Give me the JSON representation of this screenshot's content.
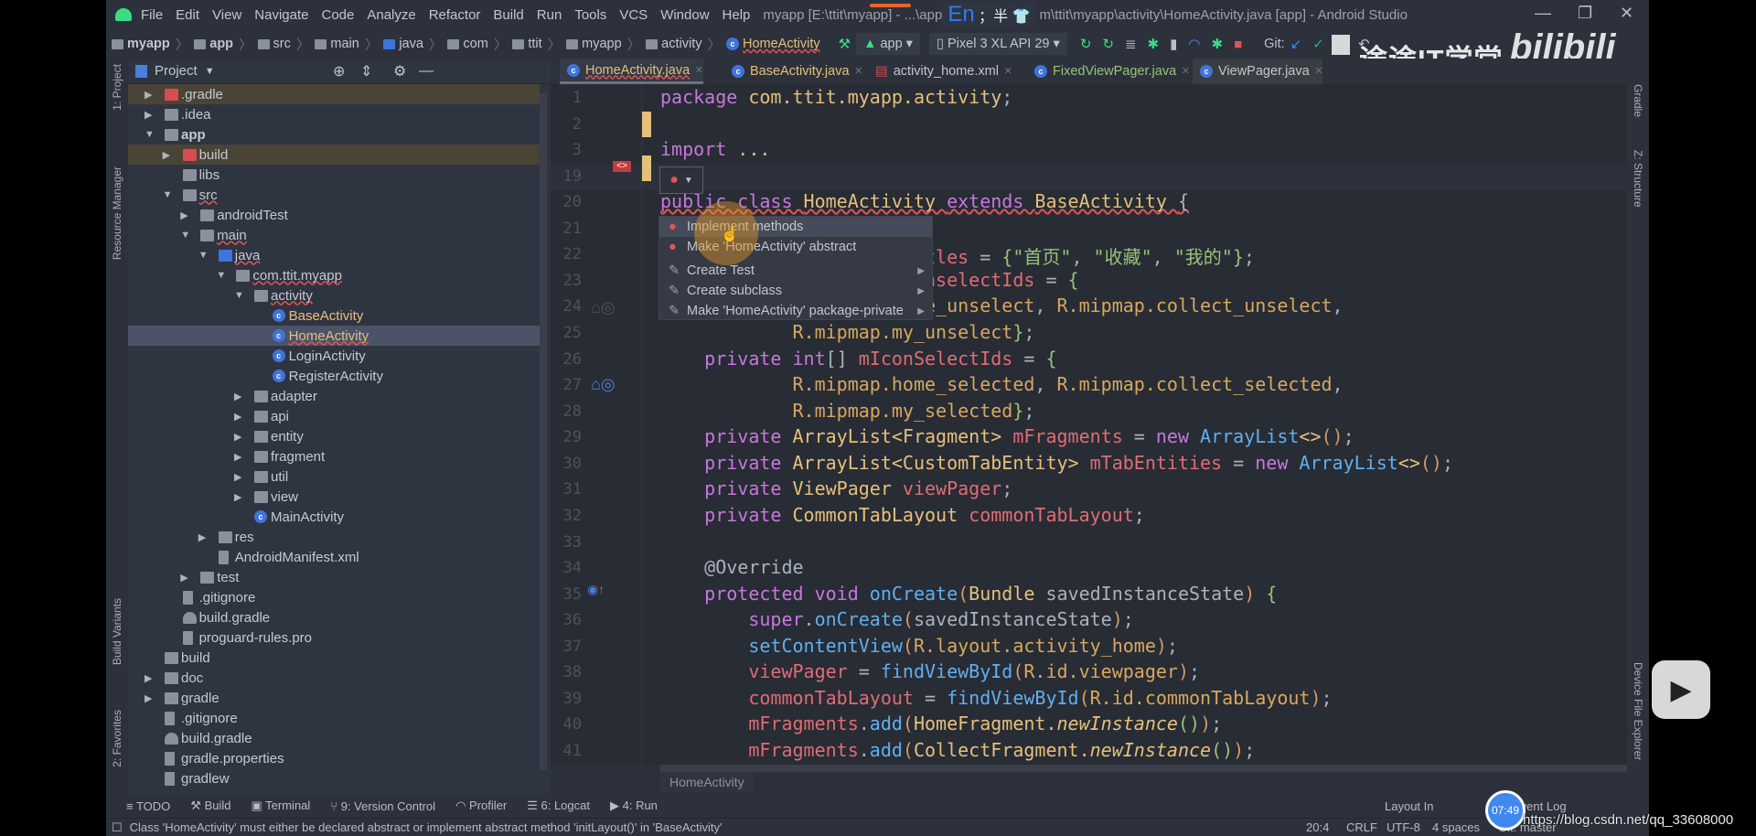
{
  "titlebar": {
    "menu": [
      "File",
      "Edit",
      "View",
      "Navigate",
      "Code",
      "Analyze",
      "Refactor",
      "Build",
      "Run",
      "Tools",
      "VCS",
      "Window",
      "Help"
    ],
    "title_left": "myapp [E:\\ttit\\myapp] - ...\\app",
    "title_right": "m\\ttit\\myapp\\activity\\HomeActivity.java [app] - Android Studio",
    "ime_lang": "En",
    "ime_extra": "；半"
  },
  "navbar": {
    "breadcrumbs": [
      "myapp",
      "app",
      "src",
      "main",
      "java",
      "com",
      "ttit",
      "myapp",
      "activity",
      "HomeActivity"
    ],
    "run_config": "app",
    "device": "Pixel 3 XL API 29",
    "git_label": "Git:"
  },
  "watermark": {
    "channel": "途途IT学堂",
    "logo": "bilibili",
    "url": "https://blog.csdn.net/qq_33608000",
    "time_bubble": "07:49"
  },
  "left_stripe": [
    "1: Project",
    "Resource Manager",
    "Build Variants",
    "2: Favorites"
  ],
  "right_stripe": [
    "Gradle",
    "Z: Structure",
    "Device File Explorer"
  ],
  "project": {
    "title": "Project",
    "tree": [
      {
        "label": ".gradle",
        "depth": 0,
        "arrow": "right",
        "icon": "folder-red",
        "hl": "brown"
      },
      {
        "label": ".idea",
        "depth": 0,
        "arrow": "right",
        "icon": "folder"
      },
      {
        "label": "app",
        "depth": 0,
        "arrow": "down",
        "icon": "module",
        "bold": true
      },
      {
        "label": "build",
        "depth": 1,
        "arrow": "right",
        "icon": "folder-red",
        "hl": "brown"
      },
      {
        "label": "libs",
        "depth": 1,
        "arrow": "",
        "icon": "folder"
      },
      {
        "label": "src",
        "depth": 1,
        "arrow": "down",
        "icon": "folder"
      },
      {
        "label": "androidTest",
        "depth": 2,
        "arrow": "right",
        "icon": "folder"
      },
      {
        "label": "main",
        "depth": 2,
        "arrow": "down",
        "icon": "folder"
      },
      {
        "label": "java",
        "depth": 3,
        "arrow": "down",
        "icon": "folder-blue"
      },
      {
        "label": "com.ttit.myapp",
        "depth": 4,
        "arrow": "down",
        "icon": "package"
      },
      {
        "label": "activity",
        "depth": 5,
        "arrow": "down",
        "icon": "package"
      },
      {
        "label": "BaseActivity",
        "depth": 6,
        "arrow": "",
        "icon": "class",
        "color": "#e5c07b"
      },
      {
        "label": "HomeActivity",
        "depth": 6,
        "arrow": "",
        "icon": "class",
        "color": "#e5c07b",
        "hl": "sel"
      },
      {
        "label": "LoginActivity",
        "depth": 6,
        "arrow": "",
        "icon": "class"
      },
      {
        "label": "RegisterActivity",
        "depth": 6,
        "arrow": "",
        "icon": "class"
      },
      {
        "label": "adapter",
        "depth": 5,
        "arrow": "right",
        "icon": "package"
      },
      {
        "label": "api",
        "depth": 5,
        "arrow": "right",
        "icon": "package"
      },
      {
        "label": "entity",
        "depth": 5,
        "arrow": "right",
        "icon": "package"
      },
      {
        "label": "fragment",
        "depth": 5,
        "arrow": "right",
        "icon": "package"
      },
      {
        "label": "util",
        "depth": 5,
        "arrow": "right",
        "icon": "package"
      },
      {
        "label": "view",
        "depth": 5,
        "arrow": "right",
        "icon": "package"
      },
      {
        "label": "MainActivity",
        "depth": 5,
        "arrow": "",
        "icon": "class"
      },
      {
        "label": "res",
        "depth": 3,
        "arrow": "right",
        "icon": "folder"
      },
      {
        "label": "AndroidManifest.xml",
        "depth": 3,
        "arrow": "",
        "icon": "manifest"
      },
      {
        "label": "test",
        "depth": 2,
        "arrow": "right",
        "icon": "folder"
      },
      {
        "label": ".gitignore",
        "depth": 1,
        "arrow": "",
        "icon": "file"
      },
      {
        "label": "build.gradle",
        "depth": 1,
        "arrow": "",
        "icon": "gradle"
      },
      {
        "label": "proguard-rules.pro",
        "depth": 1,
        "arrow": "",
        "icon": "file"
      },
      {
        "label": "build",
        "depth": 0,
        "arrow": "",
        "icon": "folder"
      },
      {
        "label": "doc",
        "depth": 0,
        "arrow": "right",
        "icon": "folder"
      },
      {
        "label": "gradle",
        "depth": 0,
        "arrow": "right",
        "icon": "folder"
      },
      {
        "label": ".gitignore",
        "depth": 0,
        "arrow": "",
        "icon": "file"
      },
      {
        "label": "build.gradle",
        "depth": 0,
        "arrow": "",
        "icon": "gradle"
      },
      {
        "label": "gradle.properties",
        "depth": 0,
        "arrow": "",
        "icon": "file"
      },
      {
        "label": "gradlew",
        "depth": 0,
        "arrow": "",
        "icon": "file"
      }
    ]
  },
  "tabs": [
    {
      "label": "HomeActivity.java",
      "active": true,
      "color": "#e5c07b",
      "icon": "class"
    },
    {
      "label": "BaseActivity.java",
      "color": "#e5c07b",
      "icon": "class"
    },
    {
      "label": "activity_home.xml",
      "color": "#c2c6ce",
      "icon": "xml"
    },
    {
      "label": "FixedViewPager.java",
      "color": "#98c379",
      "icon": "class"
    },
    {
      "label": "ViewPager.java",
      "color": "#c2c6ce",
      "icon": "class",
      "readonly": true
    }
  ],
  "editor": {
    "lines": [
      {
        "n": "1",
        "tk": [
          [
            "k",
            "package "
          ],
          [
            "t",
            "com.ttit.myapp.activity"
          ],
          [
            "p",
            ";"
          ]
        ]
      },
      {
        "n": "2",
        "tk": []
      },
      {
        "n": "3",
        "tk": [
          [
            "k",
            "import "
          ],
          [
            "t",
            "..."
          ]
        ]
      },
      {
        "n": "19",
        "tk": []
      },
      {
        "n": "20",
        "err": true,
        "tk": [
          [
            "k",
            "public class "
          ],
          [
            "t",
            "HomeActivity "
          ],
          [
            "k",
            "extends "
          ],
          [
            "t",
            "BaseActivity "
          ],
          [
            "p",
            "{"
          ]
        ]
      },
      {
        "n": "21",
        "tk": []
      },
      {
        "n": "22",
        "tk": [
          [
            "k",
            "    private "
          ],
          [
            "t",
            "String"
          ],
          [
            "p",
            "[] "
          ],
          [
            "f",
            "mTitles"
          ],
          [
            "p",
            " = "
          ],
          [
            "b",
            "{"
          ],
          [
            "s",
            "\"首页\""
          ],
          [
            "p",
            ", "
          ],
          [
            "s",
            "\"收藏\""
          ],
          [
            "p",
            ", "
          ],
          [
            "s",
            "\"我的\""
          ],
          [
            "b",
            "}"
          ],
          [
            "p",
            ";"
          ]
        ]
      },
      {
        "n": "23",
        "tk": [
          [
            "k",
            "    private int"
          ],
          [
            "p",
            "[] "
          ],
          [
            "f",
            "mIconUnselectIds"
          ],
          [
            "p",
            " = "
          ],
          [
            "b",
            "{"
          ]
        ]
      },
      {
        "n": "24",
        "tk": [
          [
            "r",
            "            R.mipmap.home_unselect"
          ],
          [
            "p",
            ", "
          ],
          [
            "r",
            "R.mipmap.collect_unselect"
          ],
          [
            "p",
            ","
          ]
        ]
      },
      {
        "n": "25",
        "tk": [
          [
            "r",
            "            R.mipmap.my_unselect"
          ],
          [
            "b",
            "}"
          ],
          [
            "p",
            ";"
          ]
        ]
      },
      {
        "n": "26",
        "tk": [
          [
            "k",
            "    private int"
          ],
          [
            "p",
            "[] "
          ],
          [
            "f",
            "mIconSelectIds"
          ],
          [
            "p",
            " = "
          ],
          [
            "b",
            "{"
          ]
        ]
      },
      {
        "n": "27",
        "tk": [
          [
            "r",
            "            R.mipmap.home_selected"
          ],
          [
            "p",
            ", "
          ],
          [
            "r",
            "R.mipmap.collect_selected"
          ],
          [
            "p",
            ","
          ]
        ]
      },
      {
        "n": "28",
        "tk": [
          [
            "r",
            "            R.mipmap.my_selected"
          ],
          [
            "b",
            "}"
          ],
          [
            "p",
            ";"
          ]
        ]
      },
      {
        "n": "29",
        "tk": [
          [
            "k",
            "    private "
          ],
          [
            "t",
            "ArrayList<Fragment> "
          ],
          [
            "f",
            "mFragments"
          ],
          [
            "p",
            " = "
          ],
          [
            "k",
            "new "
          ],
          [
            "n",
            "ArrayList"
          ],
          [
            "t",
            "<>"
          ],
          [
            "y",
            "()"
          ],
          [
            "p",
            ";"
          ]
        ]
      },
      {
        "n": "30",
        "tk": [
          [
            "k",
            "    private "
          ],
          [
            "t",
            "ArrayList<CustomTabEntity> "
          ],
          [
            "f",
            "mTabEntities"
          ],
          [
            "p",
            " = "
          ],
          [
            "k",
            "new "
          ],
          [
            "n",
            "ArrayList"
          ],
          [
            "t",
            "<>"
          ],
          [
            "y",
            "()"
          ],
          [
            "p",
            ";"
          ]
        ]
      },
      {
        "n": "31",
        "tk": [
          [
            "k",
            "    private "
          ],
          [
            "t",
            "ViewPager "
          ],
          [
            "f",
            "viewPager"
          ],
          [
            "p",
            ";"
          ]
        ]
      },
      {
        "n": "32",
        "tk": [
          [
            "k",
            "    private "
          ],
          [
            "t",
            "CommonTabLayout "
          ],
          [
            "f",
            "commonTabLayout"
          ],
          [
            "p",
            ";"
          ]
        ]
      },
      {
        "n": "33",
        "tk": []
      },
      {
        "n": "34",
        "tk": [
          [
            "p",
            "    @Override"
          ]
        ]
      },
      {
        "n": "35",
        "tk": [
          [
            "k",
            "    protected void "
          ],
          [
            "m",
            "onCreate"
          ],
          [
            "y",
            "("
          ],
          [
            "t",
            "Bundle "
          ],
          [
            "p",
            "savedInstanceState"
          ],
          [
            "y",
            ") "
          ],
          [
            "b",
            "{"
          ]
        ]
      },
      {
        "n": "36",
        "tk": [
          [
            "k",
            "        super"
          ],
          [
            "p",
            "."
          ],
          [
            "m",
            "onCreate"
          ],
          [
            "y",
            "("
          ],
          [
            "p",
            "savedInstanceState"
          ],
          [
            "y",
            ")"
          ],
          [
            "p",
            ";"
          ]
        ]
      },
      {
        "n": "37",
        "tk": [
          [
            "m",
            "        setContentView"
          ],
          [
            "y",
            "("
          ],
          [
            "r",
            "R.layout.activity_home"
          ],
          [
            "y",
            ")"
          ],
          [
            "p",
            ";"
          ]
        ]
      },
      {
        "n": "38",
        "tk": [
          [
            "f",
            "        viewPager"
          ],
          [
            "p",
            " = "
          ],
          [
            "m",
            "findViewById"
          ],
          [
            "y",
            "("
          ],
          [
            "r",
            "R.id.viewpager"
          ],
          [
            "y",
            ")"
          ],
          [
            "p",
            ";"
          ]
        ]
      },
      {
        "n": "39",
        "tk": [
          [
            "f",
            "        commonTabLayout"
          ],
          [
            "p",
            " = "
          ],
          [
            "m",
            "findViewById"
          ],
          [
            "y",
            "("
          ],
          [
            "r",
            "R.id.commonTabLayout"
          ],
          [
            "y",
            ")"
          ],
          [
            "p",
            ";"
          ]
        ]
      },
      {
        "n": "40",
        "tk": [
          [
            "f",
            "        mFragments"
          ],
          [
            "p",
            "."
          ],
          [
            "m",
            "add"
          ],
          [
            "y",
            "("
          ],
          [
            "t",
            "HomeFragment."
          ],
          [
            "i",
            "newInstance"
          ],
          [
            "b",
            "()"
          ],
          [
            "y",
            ")"
          ],
          [
            "p",
            ";"
          ]
        ]
      },
      {
        "n": "41",
        "tk": [
          [
            "f",
            "        mFragments"
          ],
          [
            "p",
            "."
          ],
          [
            "m",
            "add"
          ],
          [
            "y",
            "("
          ],
          [
            "t",
            "CollectFragment."
          ],
          [
            "i",
            "newInstance"
          ],
          [
            "b",
            "()"
          ],
          [
            "y",
            ")"
          ],
          [
            "p",
            ";"
          ]
        ]
      }
    ],
    "breadcrumb": "HomeActivity"
  },
  "popup": {
    "items": [
      {
        "label": "Implement methods",
        "icon": "bulb-red",
        "submenu": false
      },
      {
        "label": "Make 'HomeActivity' abstract",
        "icon": "bulb-red",
        "submenu": false
      },
      {
        "label": "Create Test",
        "icon": "pencil",
        "submenu": true
      },
      {
        "label": "Create subclass",
        "icon": "pencil",
        "submenu": true
      },
      {
        "label": "Make 'HomeActivity' package-private",
        "icon": "pencil",
        "submenu": true
      }
    ]
  },
  "bottom_tools": {
    "left": [
      "TODO",
      "Build",
      "Terminal",
      "9: Version Control",
      "Profiler",
      "6: Logcat",
      "4: Run"
    ],
    "right": [
      "Layout In",
      "Event Log"
    ]
  },
  "status": {
    "message": "Class 'HomeActivity' must either be declared abstract or implement abstract method 'initLayout()' in 'BaseActivity'",
    "position": "20:4",
    "line_sep": "CRLF",
    "encoding": "UTF-8",
    "indent": "4 spaces",
    "vcs": "Git: master"
  },
  "colors": {
    "editor_bg": "#282c34",
    "keyword": "#c678dd",
    "type": "#e5c07b",
    "field": "#e06c75",
    "method": "#61afef",
    "string": "#98c379",
    "error": "#e05555"
  }
}
